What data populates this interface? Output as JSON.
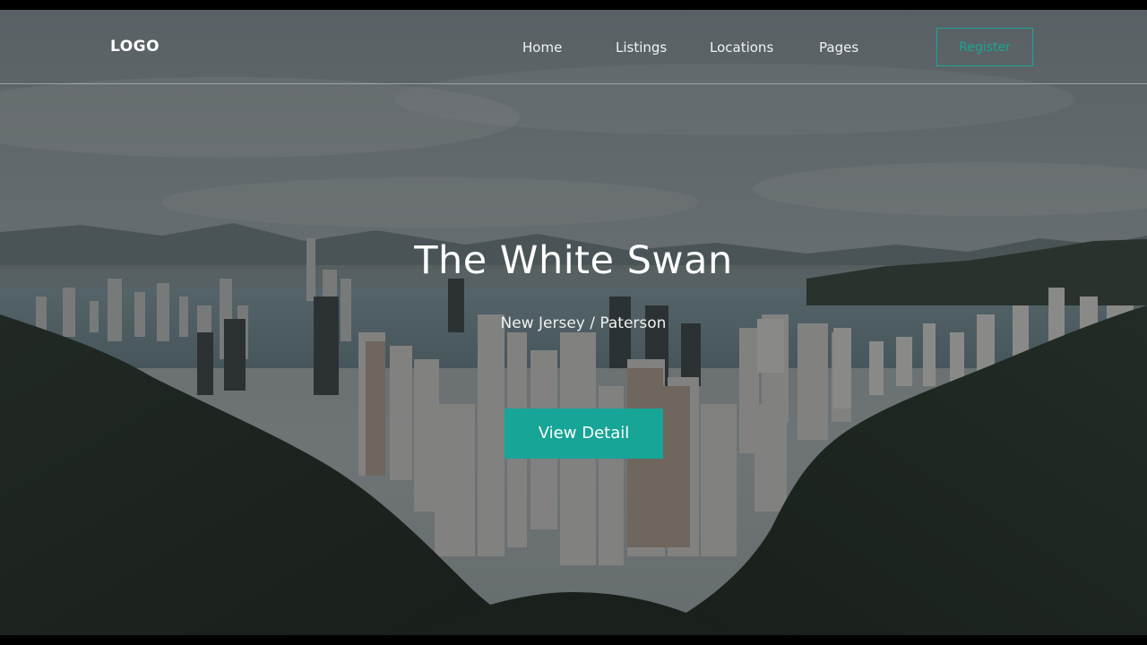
{
  "header": {
    "logo": "LOGO",
    "nav": [
      {
        "label": "Home"
      },
      {
        "label": "Listings"
      },
      {
        "label": "Locations"
      },
      {
        "label": "Pages"
      }
    ],
    "register_label": "Register"
  },
  "hero": {
    "title": "The White Swan",
    "subtitle": "New Jersey / Paterson",
    "cta_label": "View Detail",
    "background": "city-skyline-aerial-photo"
  },
  "colors": {
    "accent": "#16a596",
    "overlay": "#161a1c",
    "text": "#ffffff"
  }
}
